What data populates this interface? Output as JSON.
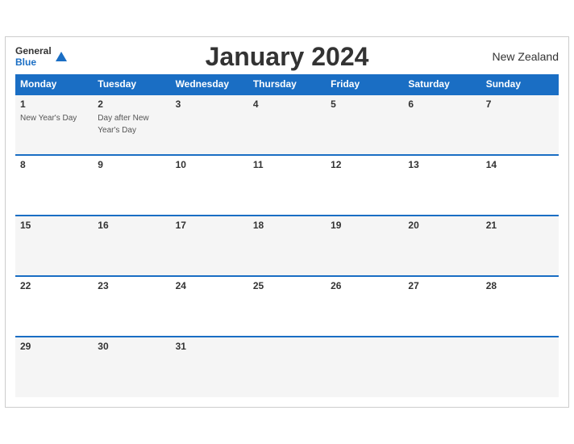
{
  "header": {
    "title": "January 2024",
    "country": "New Zealand",
    "logo_line1": "General",
    "logo_line2": "Blue"
  },
  "weekdays": [
    "Monday",
    "Tuesday",
    "Wednesday",
    "Thursday",
    "Friday",
    "Saturday",
    "Sunday"
  ],
  "weeks": [
    [
      {
        "day": "1",
        "holiday": "New Year's Day"
      },
      {
        "day": "2",
        "holiday": "Day after New Year's Day"
      },
      {
        "day": "3",
        "holiday": ""
      },
      {
        "day": "4",
        "holiday": ""
      },
      {
        "day": "5",
        "holiday": ""
      },
      {
        "day": "6",
        "holiday": ""
      },
      {
        "day": "7",
        "holiday": ""
      }
    ],
    [
      {
        "day": "8",
        "holiday": ""
      },
      {
        "day": "9",
        "holiday": ""
      },
      {
        "day": "10",
        "holiday": ""
      },
      {
        "day": "11",
        "holiday": ""
      },
      {
        "day": "12",
        "holiday": ""
      },
      {
        "day": "13",
        "holiday": ""
      },
      {
        "day": "14",
        "holiday": ""
      }
    ],
    [
      {
        "day": "15",
        "holiday": ""
      },
      {
        "day": "16",
        "holiday": ""
      },
      {
        "day": "17",
        "holiday": ""
      },
      {
        "day": "18",
        "holiday": ""
      },
      {
        "day": "19",
        "holiday": ""
      },
      {
        "day": "20",
        "holiday": ""
      },
      {
        "day": "21",
        "holiday": ""
      }
    ],
    [
      {
        "day": "22",
        "holiday": ""
      },
      {
        "day": "23",
        "holiday": ""
      },
      {
        "day": "24",
        "holiday": ""
      },
      {
        "day": "25",
        "holiday": ""
      },
      {
        "day": "26",
        "holiday": ""
      },
      {
        "day": "27",
        "holiday": ""
      },
      {
        "day": "28",
        "holiday": ""
      }
    ],
    [
      {
        "day": "29",
        "holiday": ""
      },
      {
        "day": "30",
        "holiday": ""
      },
      {
        "day": "31",
        "holiday": ""
      },
      {
        "day": "",
        "holiday": ""
      },
      {
        "day": "",
        "holiday": ""
      },
      {
        "day": "",
        "holiday": ""
      },
      {
        "day": "",
        "holiday": ""
      }
    ]
  ]
}
